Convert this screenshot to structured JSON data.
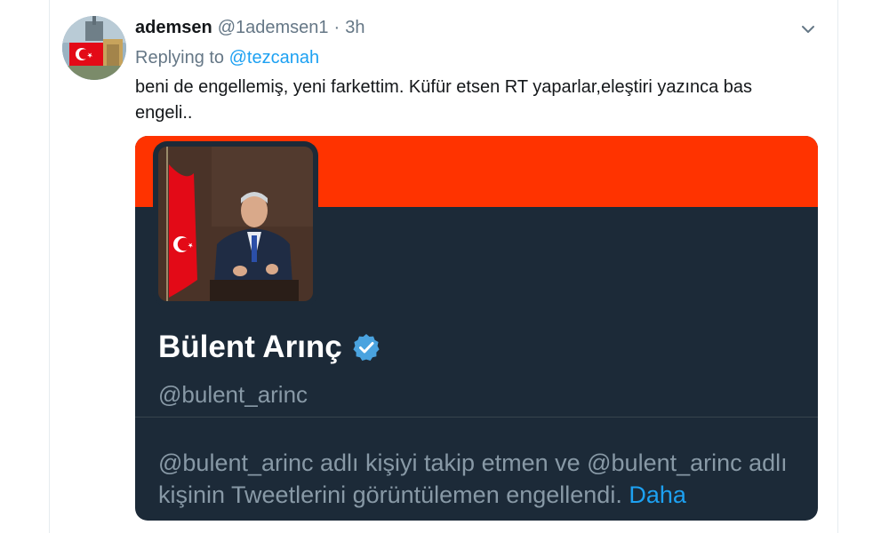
{
  "tweet": {
    "author": {
      "display_name": "ademsen",
      "handle": "@1ademsen1",
      "avatar_icon": "avatar-flag-image"
    },
    "separator": "·",
    "time": "3h",
    "replying_prefix": "Replying to",
    "replying_to": "@tezcanah",
    "text": "beni de engellemiş, yeni farkettim. Küfür etsen RT yaparlar,eleştiri yazınca bas engeli..",
    "menu_icon": "chevron-down-icon"
  },
  "embedded_card": {
    "banner_color": "#ff3300",
    "background_color": "#1c2a38",
    "profile_name": "Bülent Arınç",
    "verified_icon": "verified-badge-icon",
    "profile_handle": "@bulent_arinc",
    "blocked_message": "@bulent_arinc adlı kişiyi takip etmen ve @bulent_arinc adlı kişinin Tweetlerini görüntülemen engellendi.",
    "more_link": "Daha"
  },
  "colors": {
    "link_blue": "#1da1f2",
    "secondary_text": "#657786",
    "primary_text": "#14171a"
  }
}
